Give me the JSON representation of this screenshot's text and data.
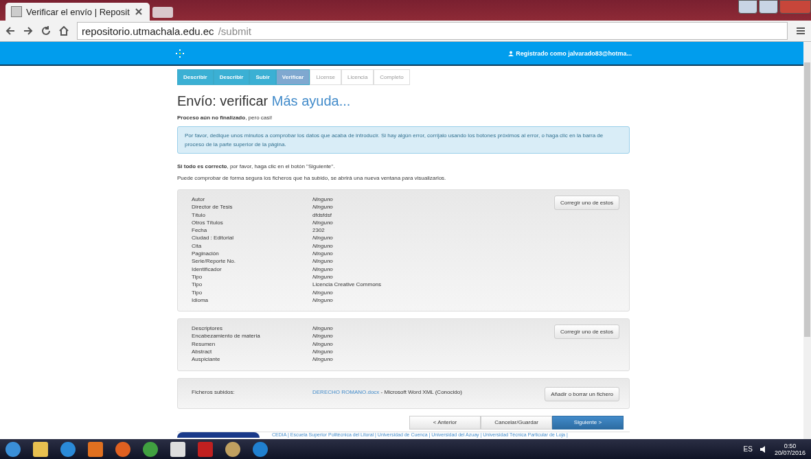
{
  "browser": {
    "tab_title": "Verificar el envío | Reposit",
    "url_host": "repositorio.utmachala.edu.ec",
    "url_path": "/submit"
  },
  "header": {
    "user": "Registrado como jalvarado83@hotma..."
  },
  "steps": [
    {
      "label": "Describir",
      "kind": "done"
    },
    {
      "label": "Describir",
      "kind": "done"
    },
    {
      "label": "Subir",
      "kind": "done"
    },
    {
      "label": "Verificar",
      "kind": "current"
    },
    {
      "label": "License",
      "kind": "pending"
    },
    {
      "label": "Licencia",
      "kind": "pending"
    },
    {
      "label": "Completo",
      "kind": "pending"
    }
  ],
  "title": "Envío: verificar",
  "help_link": "Más ayuda...",
  "status": "**Proceso aún no finalizado**, pero casi!",
  "alert": "Por favor, dedique unos minutos a comprobar los datos que acaba de introducir. Si hay algún error, corríjalo usando los botones próximos al error, o haga clic en la barra de proceso de la parte superior de la página.",
  "note": "**Si todo es correcto**, por favor, haga clic en el botón \"Siguiente\".",
  "info": "Puede comprobar de forma segura los ficheros que ha subido, se abrirá una nueva ventana para visualizarlos.",
  "sections": [
    {
      "button": "Corregir uno de estos",
      "rows": [
        {
          "label": "Autor",
          "value": "Ninguno",
          "empty": true
        },
        {
          "label": "Director de Tesis",
          "value": "Ninguno",
          "empty": true
        },
        {
          "label": "Título",
          "value": "dfdsfdsf",
          "empty": false
        },
        {
          "label": "Otros Títulos",
          "value": "Ninguno",
          "empty": true
        },
        {
          "label": "Fecha",
          "value": "2302",
          "empty": false
        },
        {
          "label": "Ciudad : Editorial",
          "value": "Ninguno",
          "empty": true
        },
        {
          "label": "Cita",
          "value": "Ninguno",
          "empty": true
        },
        {
          "label": "Paginación",
          "value": "Ninguno",
          "empty": true
        },
        {
          "label": "Serie/Reporte No.",
          "value": "Ninguno",
          "empty": true
        },
        {
          "label": "Identificador",
          "value": "Ninguno",
          "empty": true
        },
        {
          "label": "Tipo",
          "value": "Ninguno",
          "empty": true
        },
        {
          "label": "Tipo",
          "value": "Licencia Creative Commons",
          "empty": false
        },
        {
          "label": "Tipo",
          "value": "Ninguno",
          "empty": true
        },
        {
          "label": "Idioma",
          "value": "Ninguno",
          "empty": true
        }
      ]
    },
    {
      "button": "Corregir uno de estos",
      "rows": [
        {
          "label": "Descriptores",
          "value": "Ninguno",
          "empty": true
        },
        {
          "label": "Encabezamiento de materia",
          "value": "Ninguno",
          "empty": true
        },
        {
          "label": "Resumen",
          "value": "Ninguno",
          "empty": true
        },
        {
          "label": "Abstract",
          "value": "Ninguno",
          "empty": true
        },
        {
          "label": "Auspiciante",
          "value": "Ninguno",
          "empty": true
        }
      ]
    }
  ],
  "files": {
    "label": "Ficheros subidos:",
    "file_link": "DERECHO ROMANO.docx",
    "file_desc": " - Microsoft Word XML (Conocido)",
    "button": "Añadir o borrar un fichero"
  },
  "nav_buttons": [
    {
      "label": "< Anterior",
      "primary": false
    },
    {
      "label": "Cancelar/Guardar",
      "primary": false
    },
    {
      "label": "Siguiente >",
      "primary": true
    }
  ],
  "footer": "CEDIA | Escuela Superior Politécnica del Litoral | Universidad de Cuenca | Universidad del Azuay | Universidad Técnica Particular de Loja |",
  "taskbar": {
    "language": "ES",
    "time": "0:50",
    "date": "20/07/2016"
  }
}
